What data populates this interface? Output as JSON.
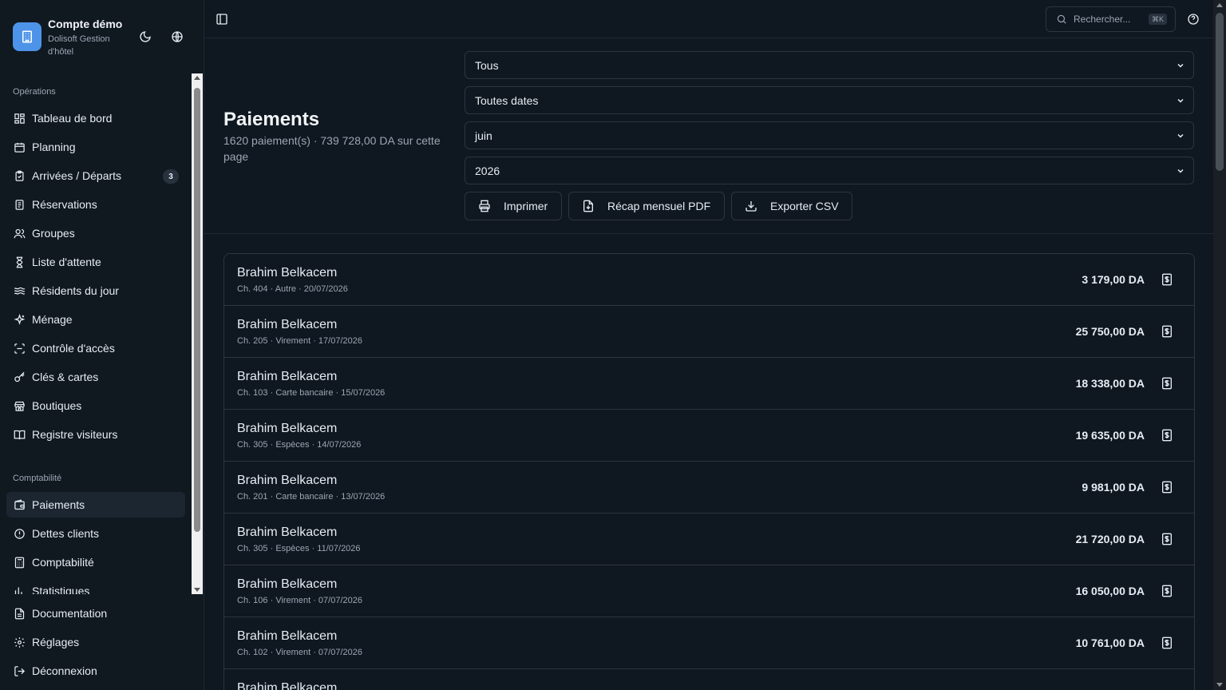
{
  "brand": {
    "title": "Compte démo",
    "subtitle": "Dolisoft Gestion d'hôtel"
  },
  "sidebar": {
    "sections": [
      {
        "label": "Opérations"
      },
      {
        "label": "Comptabilité"
      }
    ],
    "operations": [
      {
        "label": "Tableau de bord",
        "icon": "dashboard-icon"
      },
      {
        "label": "Planning",
        "icon": "calendar-icon"
      },
      {
        "label": "Arrivées / Départs",
        "icon": "clipboard-icon",
        "badge": "3"
      },
      {
        "label": "Réservations",
        "icon": "book-icon"
      },
      {
        "label": "Groupes",
        "icon": "users-icon"
      },
      {
        "label": "Liste d'attente",
        "icon": "hourglass-icon"
      },
      {
        "label": "Résidents du jour",
        "icon": "waves-icon"
      },
      {
        "label": "Ménage",
        "icon": "sparkles-icon"
      },
      {
        "label": "Contrôle d'accès",
        "icon": "scan-icon"
      },
      {
        "label": "Clés & cartes",
        "icon": "key-icon"
      },
      {
        "label": "Boutiques",
        "icon": "store-icon"
      },
      {
        "label": "Registre visiteurs",
        "icon": "open-book-icon"
      }
    ],
    "accounting": [
      {
        "label": "Paiements",
        "icon": "wallet-icon",
        "active": true
      },
      {
        "label": "Dettes clients",
        "icon": "alert-circle-icon"
      },
      {
        "label": "Comptabilité",
        "icon": "calculator-icon"
      },
      {
        "label": "Statistiques",
        "icon": "bar-chart-icon"
      }
    ],
    "bottom": [
      {
        "label": "Documentation",
        "icon": "document-icon"
      },
      {
        "label": "Réglages",
        "icon": "gear-icon"
      },
      {
        "label": "Déconnexion",
        "icon": "logout-icon"
      }
    ]
  },
  "topbar": {
    "search_placeholder": "Rechercher...",
    "shortcut": "⌘K"
  },
  "page": {
    "title": "Paiements",
    "subtitle": "1620 paiement(s) · 739 728,00 DA sur cette page"
  },
  "filters": {
    "method": "Tous",
    "period": "Toutes dates",
    "month": "juin",
    "year": "2026"
  },
  "actions": {
    "print": "Imprimer",
    "monthly_pdf": "Récap mensuel PDF",
    "export_csv": "Exporter CSV"
  },
  "payments": [
    {
      "name": "Brahim Belkacem",
      "room": "Ch. 404",
      "method": "Autre",
      "date": "20/07/2026",
      "amount": "3 179,00 DA"
    },
    {
      "name": "Brahim Belkacem",
      "room": "Ch. 205",
      "method": "Virement",
      "date": "17/07/2026",
      "amount": "25 750,00 DA"
    },
    {
      "name": "Brahim Belkacem",
      "room": "Ch. 103",
      "method": "Carte bancaire",
      "date": "15/07/2026",
      "amount": "18 338,00 DA"
    },
    {
      "name": "Brahim Belkacem",
      "room": "Ch. 305",
      "method": "Espèces",
      "date": "14/07/2026",
      "amount": "19 635,00 DA"
    },
    {
      "name": "Brahim Belkacem",
      "room": "Ch. 201",
      "method": "Carte bancaire",
      "date": "13/07/2026",
      "amount": "9 981,00 DA"
    },
    {
      "name": "Brahim Belkacem",
      "room": "Ch. 305",
      "method": "Espèces",
      "date": "11/07/2026",
      "amount": "21 720,00 DA"
    },
    {
      "name": "Brahim Belkacem",
      "room": "Ch. 106",
      "method": "Virement",
      "date": "07/07/2026",
      "amount": "16 050,00 DA"
    },
    {
      "name": "Brahim Belkacem",
      "room": "Ch. 102",
      "method": "Virement",
      "date": "07/07/2026",
      "amount": "10 761,00 DA"
    },
    {
      "name": "Brahim Belkacem",
      "room": "",
      "method": "",
      "date": "",
      "amount": ""
    }
  ]
}
